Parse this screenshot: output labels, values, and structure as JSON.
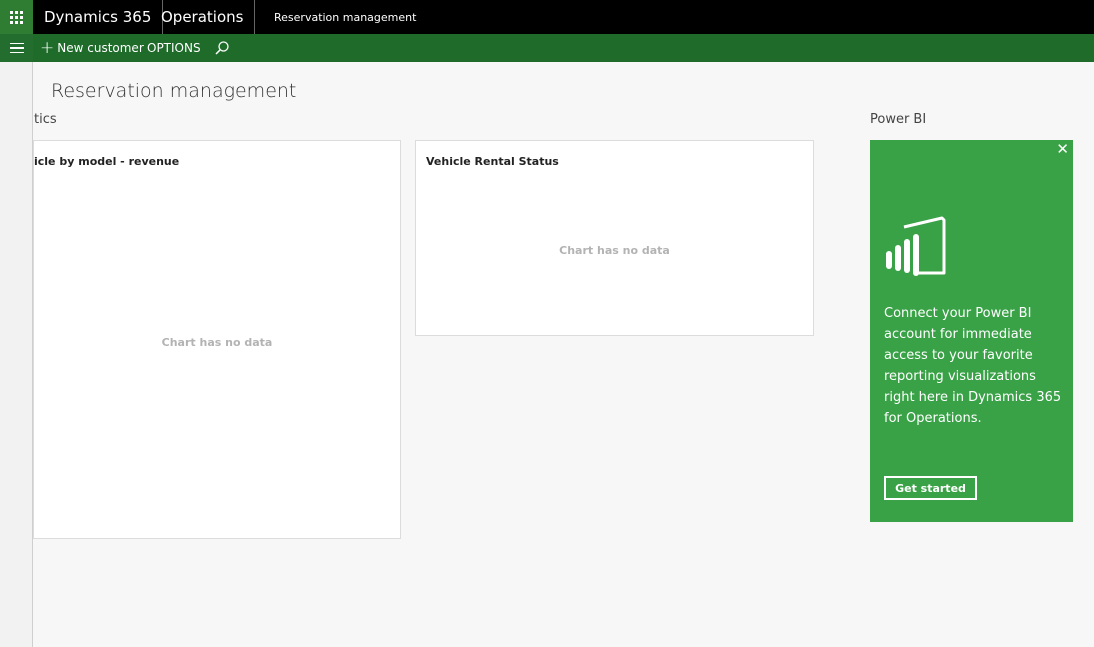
{
  "topbar": {
    "brand": "Dynamics 365",
    "module": "Operations",
    "breadcrumb": "Reservation management"
  },
  "actionbar": {
    "new_customer_label": "New customer",
    "options_label": "OPTIONS"
  },
  "page": {
    "title": "Reservation management",
    "analytics_label": "tics",
    "powerbi_label": "Power BI"
  },
  "tiles": [
    {
      "title": "icle by model - revenue",
      "empty_text": "Chart has no data"
    },
    {
      "title": "Vehicle Rental Status",
      "empty_text": "Chart has no data"
    }
  ],
  "powerbi_card": {
    "close_glyph": "✕",
    "message": "Connect your Power BI account for immediate access to your favorite reporting visualizations right here in Dynamics 365 for Operations.",
    "button_label": "Get started"
  },
  "colors": {
    "topbar": "#000000",
    "actionbar": "#1e6b2a",
    "waffle": "#2e7d32",
    "powerbi_card": "#39a247"
  },
  "icons": [
    "app-launcher-icon",
    "hamburger-icon",
    "plus-icon",
    "search-icon",
    "close-icon",
    "power-bi-logo-icon"
  ]
}
